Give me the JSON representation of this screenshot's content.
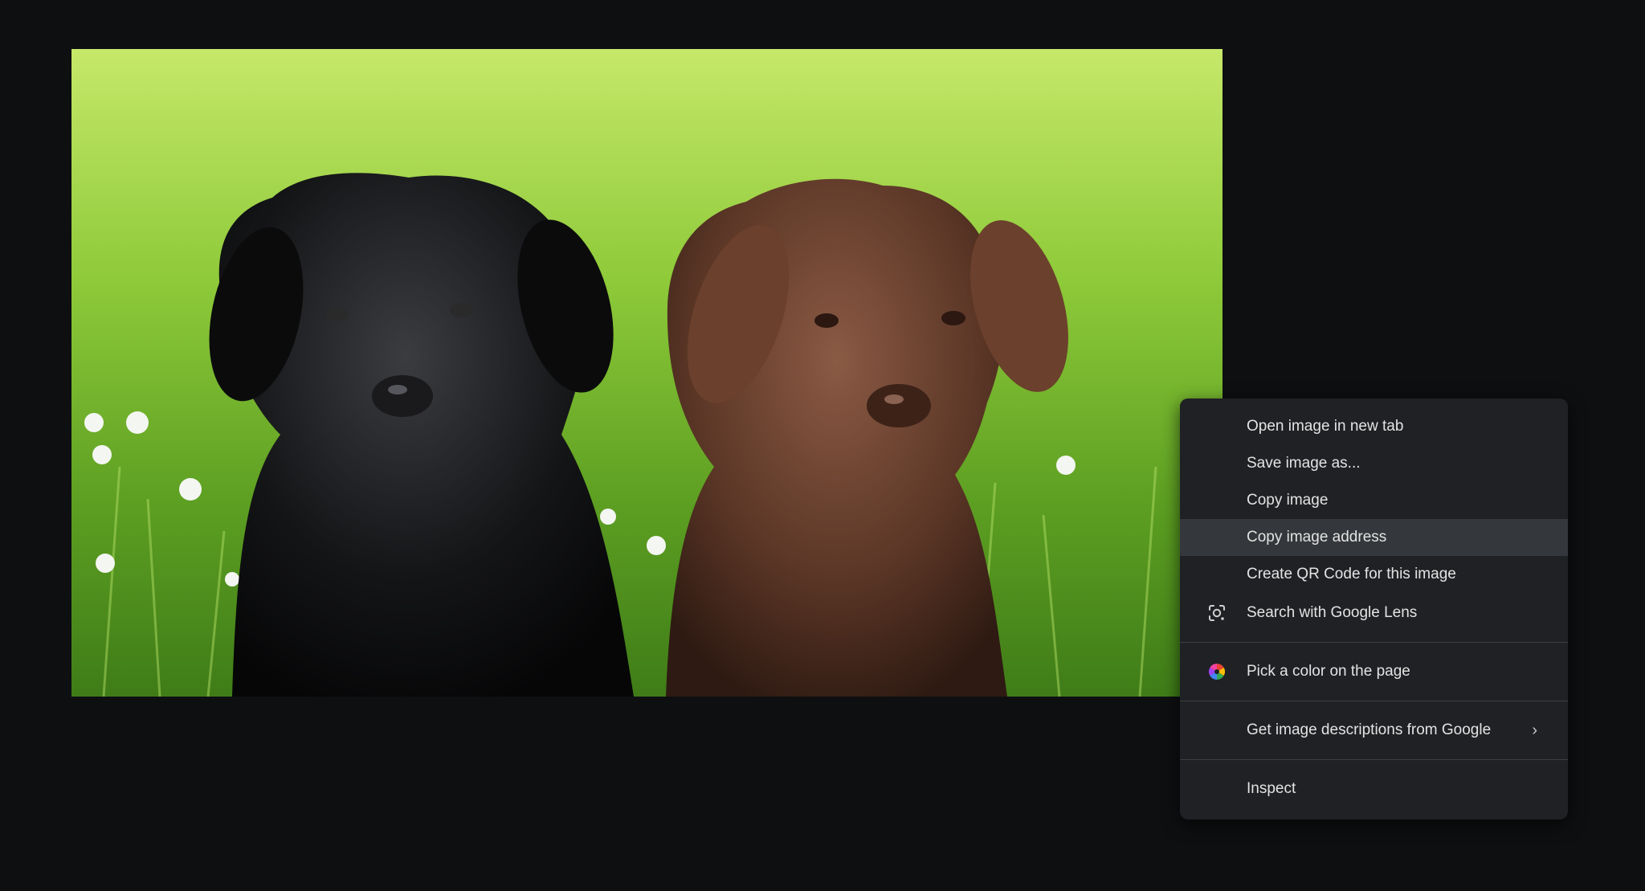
{
  "photo": {
    "icon": "puppies-photo"
  },
  "context_menu": {
    "items": [
      {
        "label": "Open image in new tab"
      },
      {
        "label": "Save image as..."
      },
      {
        "label": "Copy image"
      },
      {
        "label": "Copy image address",
        "hovered": true
      },
      {
        "label": "Create QR Code for this image"
      },
      {
        "label": "Search with Google Lens",
        "icon": "google-lens-icon"
      },
      {
        "label": "Pick a color on the page",
        "icon": "color-picker-icon"
      },
      {
        "label": "Get image descriptions from Google",
        "icon": "chevron-right-icon"
      },
      {
        "label": "Inspect"
      }
    ]
  },
  "colors": {
    "background": "#0e0f11",
    "menu_background": "#1f2124",
    "menu_hover": "#34373b",
    "menu_text": "#e3e3e3",
    "separator": "#3c3f43"
  }
}
